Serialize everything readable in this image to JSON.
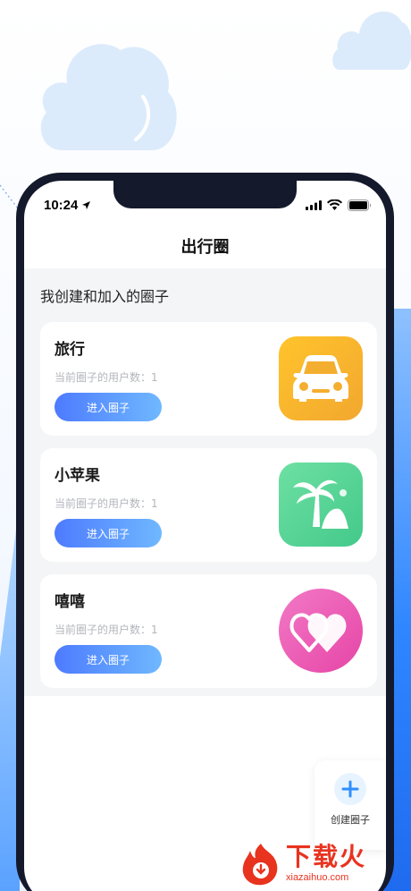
{
  "status_bar": {
    "time": "10:24"
  },
  "header": {
    "title": "出行圈"
  },
  "section": {
    "title": "我创建和加入的圈子"
  },
  "circles": [
    {
      "name": "旅行",
      "subtitle": "当前圈子的用户数：1",
      "button": "进入圈子",
      "icon": "car-icon"
    },
    {
      "name": "小苹果",
      "subtitle": "当前圈子的用户数：1",
      "button": "进入圈子",
      "icon": "palm-tree-icon"
    },
    {
      "name": "嘻嘻",
      "subtitle": "当前圈子的用户数：1",
      "button": "进入圈子",
      "icon": "double-heart-icon"
    }
  ],
  "fab": {
    "label": "创建圈子",
    "icon": "plus-icon"
  },
  "watermark": {
    "title": "下载火",
    "url": "xiazaihuo.com"
  },
  "colors": {
    "button_gradient_start": "#4d7bff",
    "button_gradient_end": "#6fb8ff",
    "car_icon_bg": "#f5b12f",
    "palm_icon_bg": "#55d696",
    "heart_icon_bg": "#ea5bb4",
    "watermark": "#e8331f"
  }
}
